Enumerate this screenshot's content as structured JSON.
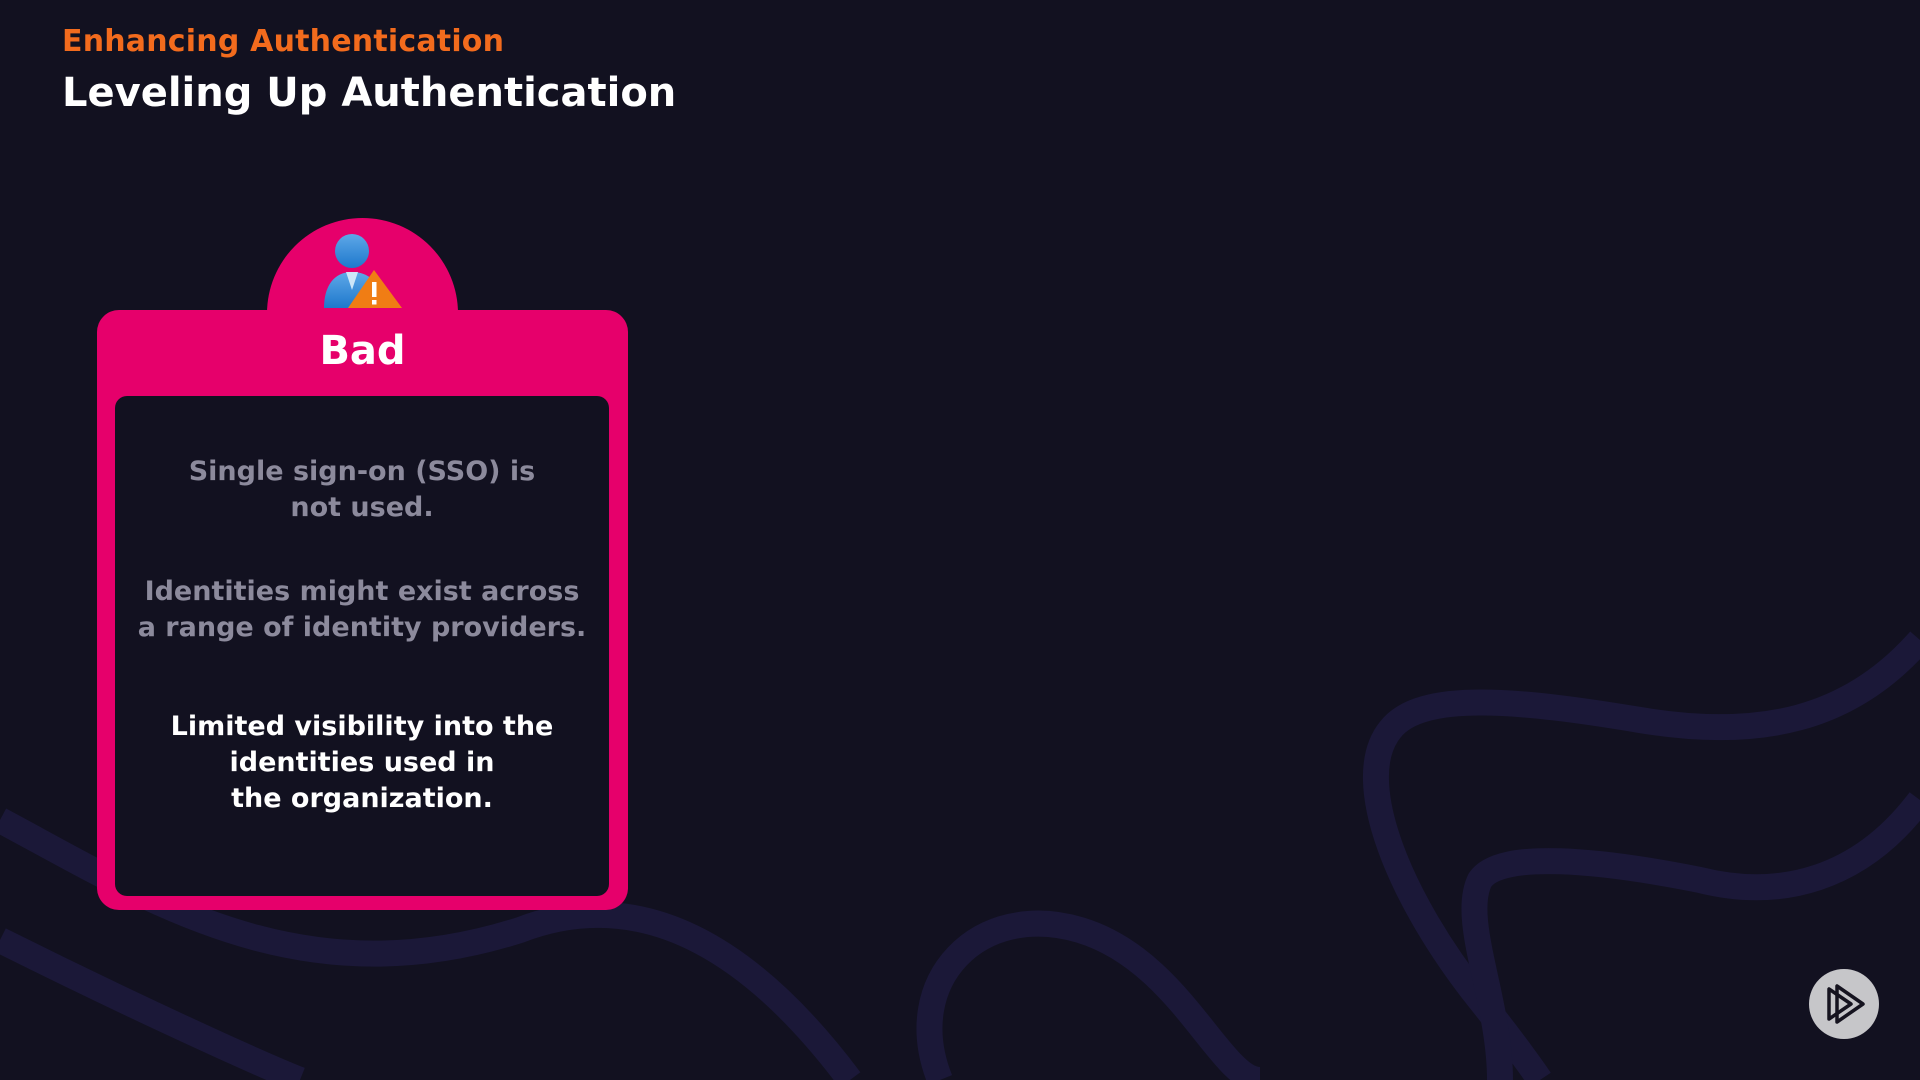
{
  "header": {
    "kicker": "Enhancing Authentication",
    "title": "Leveling Up Authentication"
  },
  "card": {
    "icon": "user-warning-icon",
    "title": "Bad",
    "accent_color": "#e6006b",
    "points": [
      {
        "lines": [
          "Single sign-on (SSO) is",
          "not used."
        ],
        "highlighted": false
      },
      {
        "lines": [
          "Identities might exist across",
          "a range of identity providers."
        ],
        "highlighted": false
      },
      {
        "lines": [
          "Limited visibility into the",
          "identities used in",
          "the organization."
        ],
        "highlighted": true
      }
    ]
  },
  "brand": {
    "icon": "play-logo-icon"
  },
  "colors": {
    "background": "#121120",
    "kicker": "#f26b1d",
    "dim_text": "#8c8a9c"
  }
}
